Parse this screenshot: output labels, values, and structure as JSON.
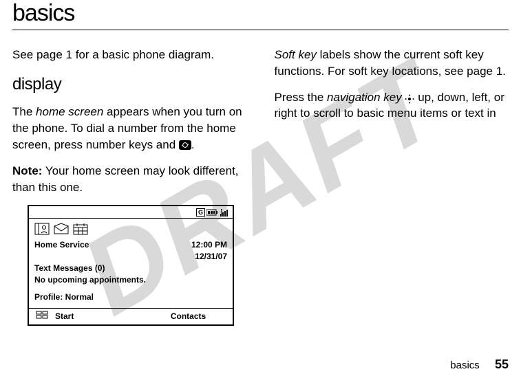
{
  "watermark": "DRAFT",
  "title": "basics",
  "left_col": {
    "intro": "See page 1 for a basic phone diagram.",
    "display_heading": "display",
    "p1_a": "The ",
    "p1_home_screen": "home screen",
    "p1_b": " appears when you turn on the phone. To dial a number from the home screen, press number keys and ",
    "p1_c": ".",
    "p2_note": "Note:",
    "p2_rest": " Your home screen may look different, than this one."
  },
  "phone": {
    "top_g": "G",
    "home_service": "Home Service",
    "time": "12:00 PM",
    "date": "12/31/07",
    "text_messages": "Text Messages (0)",
    "no_appt": "No upcoming appointments.",
    "profile": "Profile: Normal",
    "soft_left": "Start",
    "soft_right": "Contacts"
  },
  "right_col": {
    "p1_a": "Soft key",
    "p1_b": " labels show the current soft key functions. For soft key locations, see page 1.",
    "p2_a": "Press the ",
    "p2_navkey": "navigation key",
    "p2_b": " ",
    "p2_c": " up, down, left, or right to scroll to basic menu items or text in"
  },
  "footer": {
    "section": "basics",
    "page": "55"
  }
}
